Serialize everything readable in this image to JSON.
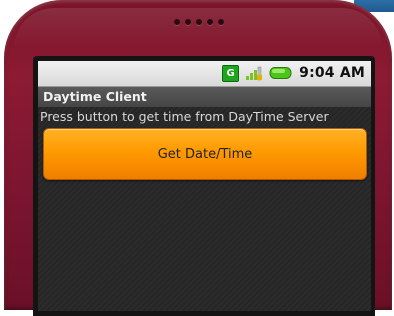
{
  "status_bar": {
    "network_label": "G",
    "time": "9:04 AM",
    "icons": [
      "network-g-icon",
      "signal-icon",
      "battery-icon"
    ]
  },
  "app": {
    "title": "Daytime Client",
    "instruction": "Press button to get time from DayTime Server",
    "button_label": "Get Date/Time"
  },
  "colors": {
    "phone_body": "#7d1530",
    "button_orange": "#ff9a00",
    "network_green": "#1fa51f",
    "title_bar": "#4e4e4e"
  }
}
